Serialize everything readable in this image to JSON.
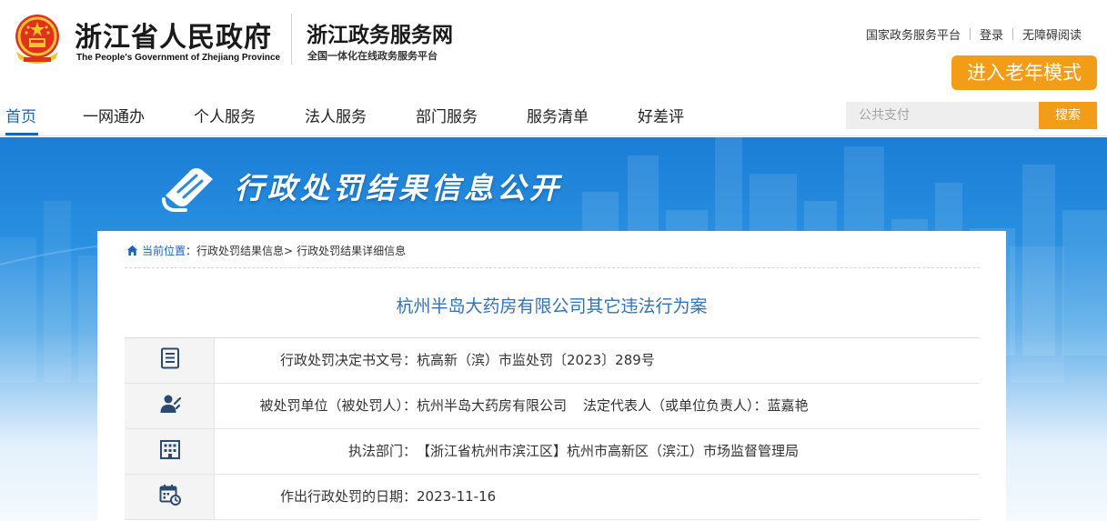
{
  "header": {
    "gov_title": "浙江省人民政府",
    "gov_subtitle": "The People's Government of Zhejiang Province",
    "portal_title": "浙江政务服务网",
    "portal_subtitle": "全国一体化在线政务服务平台",
    "top_links": [
      "国家政务服务平台",
      "登录",
      "无障碍阅读"
    ],
    "elder_mode_label": "进入老年模式"
  },
  "nav": {
    "items": [
      "首页",
      "一网通办",
      "个人服务",
      "法人服务",
      "部门服务",
      "服务清单",
      "好差评"
    ],
    "active_index": 0
  },
  "search": {
    "placeholder": "公共支付",
    "button_label": "搜索"
  },
  "banner": {
    "title": "行政处罚结果信息公开"
  },
  "breadcrumb": {
    "current_label": "当前位置",
    "items": [
      "行政处罚结果信息>",
      "行政处罚结果详细信息"
    ]
  },
  "case": {
    "title": "杭州半岛大药房有限公司其它违法行为案",
    "rows": [
      {
        "icon": "document-list-icon",
        "label": "行政处罚决定书文号：",
        "value": "杭高新（滨）市监处罚〔2023〕289号"
      },
      {
        "icon": "user-icon",
        "label": "被处罚单位（被处罚人）：",
        "value": "杭州半岛大药房有限公司",
        "extra_label": "法定代表人（或单位负责人）：",
        "extra_value": "蓝嘉艳"
      },
      {
        "icon": "building-icon",
        "label": "执法部门：",
        "value": "【浙江省杭州市滨江区】杭州市高新区（滨江）市场监督管理局"
      },
      {
        "icon": "calendar-clock-icon",
        "label": "作出行政处罚的日期：",
        "value": "2023-11-16"
      }
    ]
  },
  "colors": {
    "accent_orange": "#f39c17",
    "link_blue": "#1565c0",
    "title_blue": "#2f72b8",
    "banner_blue": "#1a7ed6"
  }
}
